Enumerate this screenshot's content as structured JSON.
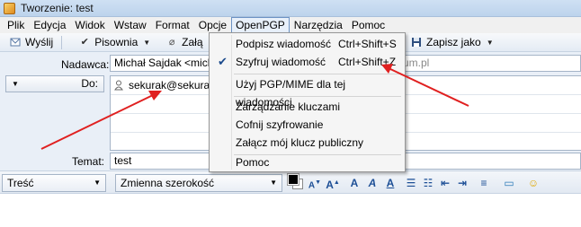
{
  "window": {
    "title": "Tworzenie: test"
  },
  "menubar": {
    "items": [
      "Plik",
      "Edycja",
      "Widok",
      "Wstaw",
      "Format",
      "Opcje",
      "OpenPGP",
      "Narzędzia",
      "Pomoc"
    ]
  },
  "toolbar": {
    "send": "Wyślij",
    "spelling": "Pisownia",
    "attach": "Załą",
    "save": "Zapisz jako"
  },
  "headers": {
    "from_label": "Nadawca:",
    "from_value": "Michał Sajdak <micha",
    "from_value_suffix": "um.pl",
    "to_label": "Do:",
    "to_value": "sekurak@sekurak.p",
    "subject_label": "Temat:",
    "subject_value": "test"
  },
  "formatbar": {
    "paragraph": "Treść",
    "font": "Zmienna szerokość"
  },
  "openpgp_menu": {
    "items": [
      {
        "label": "Podpisz wiadomość",
        "shortcut": "Ctrl+Shift+S",
        "checked": false
      },
      {
        "label": "Szyfruj wiadomość",
        "shortcut": "Ctrl+Shift+Z",
        "checked": true
      },
      {
        "label": "Użyj PGP/MIME dla tej wiadomości",
        "shortcut": "",
        "checked": false
      },
      {
        "label": "Zarządzanie kluczami",
        "shortcut": "",
        "checked": false
      },
      {
        "label": "Cofnij szyfrowanie",
        "shortcut": "",
        "checked": false
      },
      {
        "label": "Załącz mój klucz publiczny",
        "shortcut": "",
        "checked": false
      },
      {
        "label": "Pomoc",
        "shortcut": "",
        "checked": false
      }
    ]
  },
  "colors": {
    "annotation_arrow": "#e02020",
    "menu_highlight": "#dde9f7"
  }
}
